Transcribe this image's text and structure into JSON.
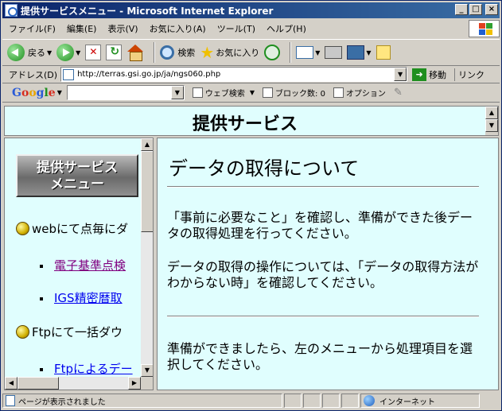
{
  "window": {
    "title": "提供サービスメニュー - Microsoft Internet Explorer",
    "buttons": {
      "minimize": "_",
      "maximize": "□",
      "close": "×"
    }
  },
  "menubar": [
    "ファイル(F)",
    "編集(E)",
    "表示(V)",
    "お気に入り(A)",
    "ツール(T)",
    "ヘルプ(H)"
  ],
  "toolbar": {
    "back": "戻る",
    "search": "検索",
    "favorites": "お気に入り"
  },
  "address": {
    "label": "アドレス(D)",
    "url": "http://terras.gsi.go.jp/ja/ngs060.php",
    "go": "移動",
    "links": "リンク"
  },
  "google": {
    "logo": [
      "G",
      "o",
      "o",
      "g",
      "l",
      "e"
    ],
    "web_search": "ウェブ検索",
    "block_count": "ブロック数: 0",
    "options": "オプション"
  },
  "top_frame": {
    "title": "提供サービス"
  },
  "left_frame": {
    "menu_button": {
      "line1": "提供サービス",
      "line2": "メニュー"
    },
    "section1": "webにて点毎にダ",
    "links1": [
      "電子基準点検",
      "IGS精密暦取"
    ],
    "section2": "Ftpにて一括ダウ",
    "links2": [
      "Ftpによるデー"
    ]
  },
  "right_frame": {
    "title": "データの取得について",
    "para1": "「事前に必要なこと」を確認し、準備ができた後データの取得処理を行ってください。",
    "para2": "データの取得の操作については、「データの取得方法がわからない時」を確認してください。",
    "para3": "準備ができましたら、左のメニューから処理項目を選択してください。"
  },
  "status": {
    "text": "ページが表示されました",
    "zone": "インターネット"
  }
}
